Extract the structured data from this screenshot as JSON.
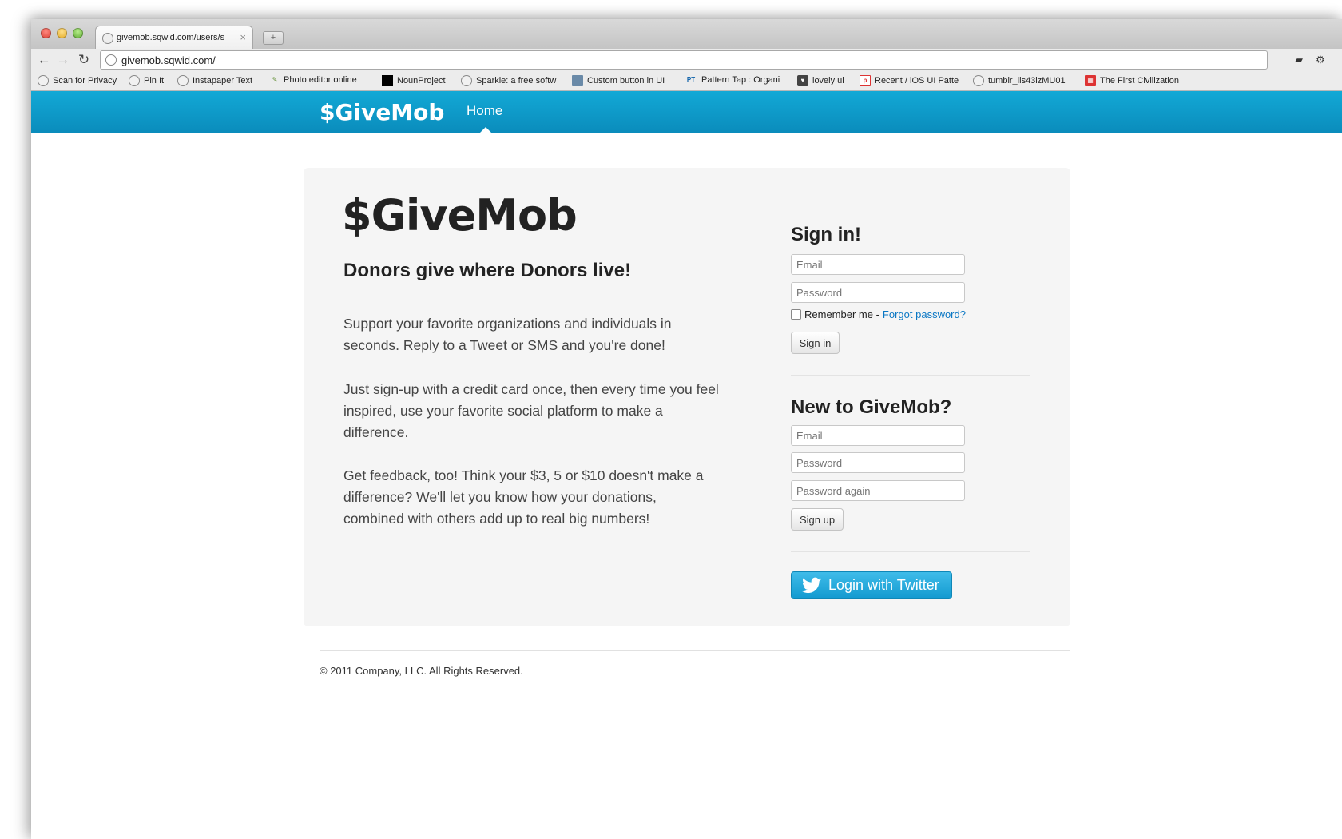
{
  "browser": {
    "tab_title": "givemob.sqwid.com/users/s",
    "tab_close": "×",
    "new_tab": "+",
    "url": "givemob.sqwid.com/",
    "nav": {
      "back": "←",
      "forward": "→",
      "reload": "↻"
    },
    "bookmarks": [
      {
        "label": "Scan for Privacy",
        "icon": "globe-icon"
      },
      {
        "label": "Pin It",
        "icon": "globe-icon"
      },
      {
        "label": "Instapaper Text",
        "icon": "globe-icon"
      },
      {
        "label": "Photo editor online",
        "icon": "pen-icon"
      },
      {
        "label": "NounProject",
        "icon": "square-icon"
      },
      {
        "label": "Sparkle: a free softw",
        "icon": "globe-icon"
      },
      {
        "label": "Custom button in UI",
        "icon": "image-icon"
      },
      {
        "label": "Pattern Tap : Organi",
        "icon": "pt-icon"
      },
      {
        "label": "lovely ui",
        "icon": "shield-icon"
      },
      {
        "label": "Recent / iOS UI Patte",
        "icon": "p-icon"
      },
      {
        "label": "tumblr_lls43izMU01",
        "icon": "globe-icon"
      },
      {
        "label": "The First Civilization",
        "icon": "grid-icon"
      }
    ]
  },
  "navbar": {
    "brand": "$GiveMob",
    "home": "Home"
  },
  "hero": {
    "title": "$GiveMob",
    "tagline": "Donors give where Donors live!",
    "paragraphs": [
      "Support your favorite organizations and individuals in seconds. Reply to a Tweet or SMS and you're done!",
      "Just sign-up with a credit card once, then every time you feel inspired, use your favorite social platform to make a difference.",
      "Get feedback, too! Think your $3, 5 or $10 doesn't make a difference? We'll let you know how your donations, combined with others add up to real big numbers!"
    ]
  },
  "signin": {
    "heading": "Sign in!",
    "email_placeholder": "Email",
    "password_placeholder": "Password",
    "remember": "Remember me -",
    "forgot": "Forgot password?",
    "button": "Sign in"
  },
  "signup": {
    "heading": "New to GiveMob?",
    "email_placeholder": "Email",
    "password_placeholder": "Password",
    "password_again_placeholder": "Password again",
    "button": "Sign up"
  },
  "twitter": {
    "button": "Login with Twitter"
  },
  "footer": {
    "text": "© 2011 Company, LLC. All Rights Reserved."
  },
  "colors": {
    "navbar": "#0a8cbc",
    "link": "#0a77c4",
    "twitter_button": "#139ad0"
  }
}
